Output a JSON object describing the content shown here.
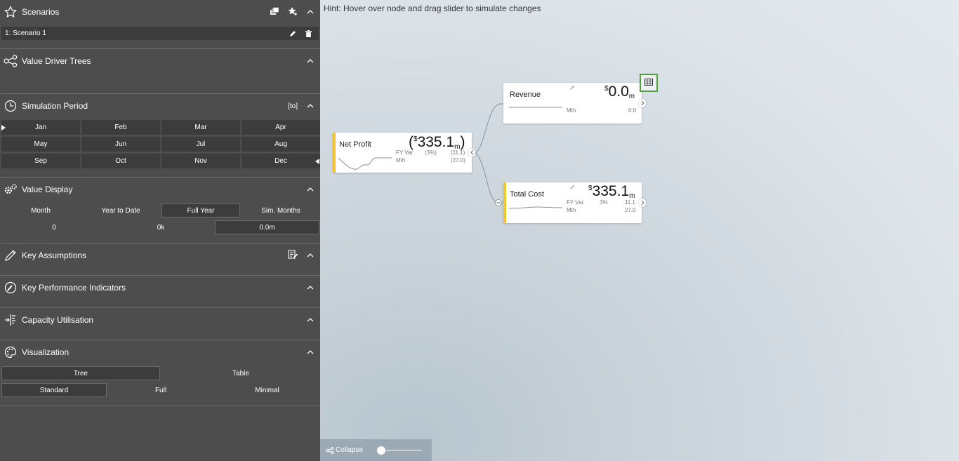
{
  "sidebar": {
    "scenarios": {
      "title": "Scenarios",
      "item": "1: Scenario 1"
    },
    "vdt": {
      "title": "Value Driver Trees"
    },
    "sim": {
      "title": "Simulation Period",
      "to_label": "[to]",
      "months": [
        "Jan",
        "Feb",
        "Mar",
        "Apr",
        "May",
        "Jun",
        "Jul",
        "Aug",
        "Sep",
        "Oct",
        "Nov",
        "Dec"
      ]
    },
    "value_display": {
      "title": "Value Display",
      "options": [
        "Month",
        "Year to Date",
        "Full Year",
        "Sim. Months"
      ],
      "selected": "Full Year",
      "values": [
        "0",
        "0k",
        "0.0m"
      ]
    },
    "key_assumptions": {
      "title": "Key Assumptions"
    },
    "kpi": {
      "title": "Key Performance Indicators"
    },
    "capacity": {
      "title": "Capacity Utilisation"
    },
    "visualization": {
      "title": "Visualization",
      "views": [
        "Tree",
        "Table"
      ],
      "modes": [
        "Standard",
        "Full",
        "Minimal"
      ]
    }
  },
  "canvas": {
    "hint": "Hint: Hover over node and drag slider to simulate changes",
    "collapse_label": "Collapse",
    "zoom_level": 0.0,
    "nodes": {
      "net_profit": {
        "name": "Net Profit",
        "prefix": "(",
        "currency": "$",
        "value": "335.1",
        "unit": "m",
        "suffix": ")",
        "fy_label": "FY Var.",
        "fy_pct": "(3%)",
        "fy_val": "(11.1)",
        "mth_label": "Mth",
        "mth_val": "(27.0)"
      },
      "revenue": {
        "name": "Revenue",
        "currency": "$",
        "value": "0.0",
        "unit": "m",
        "mth_label": "Mth",
        "mth_val": "0.0"
      },
      "total_cost": {
        "name": "Total Cost",
        "currency": "$",
        "value": "335.1",
        "unit": "m",
        "fy_label": "FY Var.",
        "fy_pct": "3%",
        "fy_val": "11.1",
        "mth_label": "Mth",
        "mth_val": "27.0"
      }
    }
  },
  "colors": {
    "sidebar": "#4d4d4d",
    "button": "#3c3c3c",
    "accent_yellow": "#f6c334",
    "highlight_green": "#4fa33a"
  }
}
